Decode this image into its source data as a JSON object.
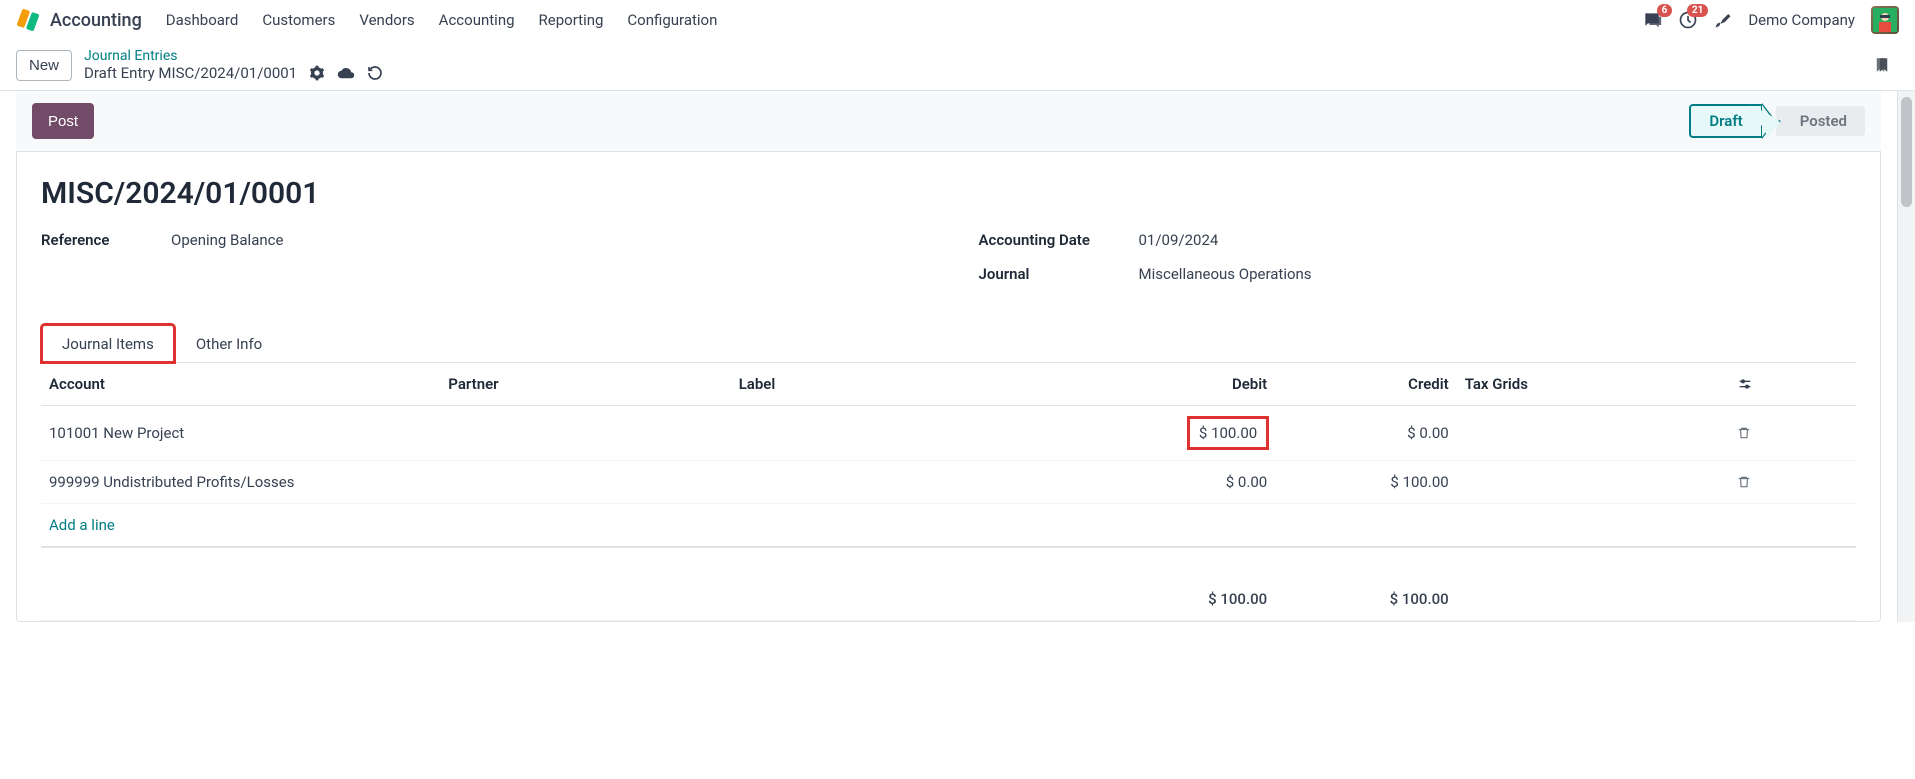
{
  "app": {
    "name": "Accounting"
  },
  "nav": {
    "items": [
      "Dashboard",
      "Customers",
      "Vendors",
      "Accounting",
      "Reporting",
      "Configuration"
    ]
  },
  "topbar": {
    "chat_badge": "6",
    "activity_badge": "21",
    "company": "Demo Company"
  },
  "breadcrumb": {
    "new": "New",
    "parent": "Journal Entries",
    "current": "Draft Entry MISC/2024/01/0001"
  },
  "actions": {
    "post": "Post"
  },
  "status": {
    "draft": "Draft",
    "posted": "Posted"
  },
  "record": {
    "title": "MISC/2024/01/0001",
    "reference_label": "Reference",
    "reference_value": "Opening Balance",
    "date_label": "Accounting Date",
    "date_value": "01/09/2024",
    "journal_label": "Journal",
    "journal_value": "Miscellaneous Operations"
  },
  "tabs": {
    "journal_items": "Journal Items",
    "other_info": "Other Info"
  },
  "table": {
    "headers": {
      "account": "Account",
      "partner": "Partner",
      "label": "Label",
      "debit": "Debit",
      "credit": "Credit",
      "tax_grids": "Tax Grids"
    },
    "rows": [
      {
        "account": "101001 New Project",
        "partner": "",
        "label": "",
        "debit": "$ 100.00",
        "credit": "$ 0.00",
        "tax_grids": ""
      },
      {
        "account": "999999 Undistributed Profits/Losses",
        "partner": "",
        "label": "",
        "debit": "$ 0.00",
        "credit": "$ 100.00",
        "tax_grids": ""
      }
    ],
    "add_line": "Add a line",
    "totals": {
      "debit": "$ 100.00",
      "credit": "$ 100.00"
    }
  }
}
